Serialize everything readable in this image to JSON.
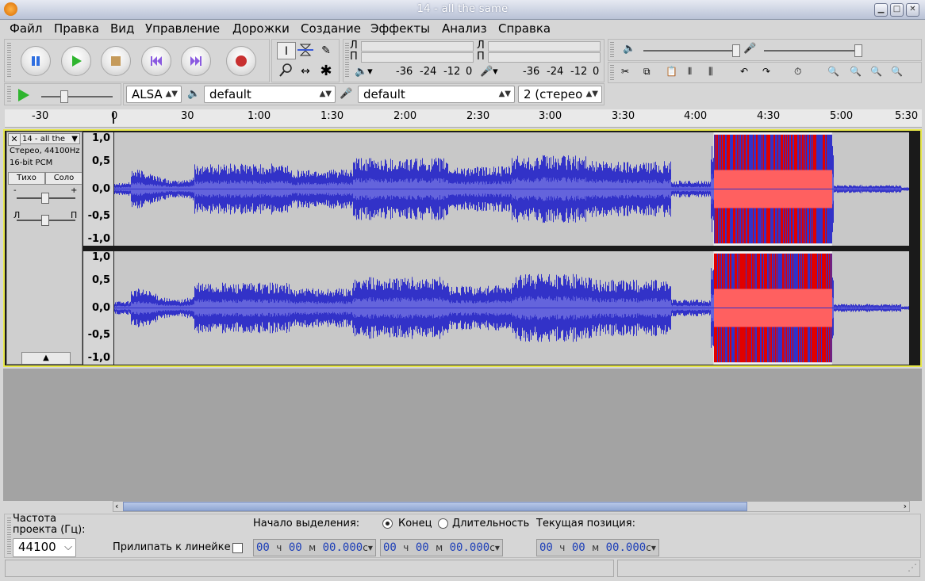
{
  "window": {
    "title": "14 - all the same"
  },
  "menu": [
    {
      "label": "Файл"
    },
    {
      "label": "Правка"
    },
    {
      "label": "Вид"
    },
    {
      "label": "Управление"
    },
    {
      "label": "Дорожки"
    },
    {
      "label": "Создание"
    },
    {
      "label": "Эффекты"
    },
    {
      "label": "Анализ"
    },
    {
      "label": "Справка"
    }
  ],
  "meters": {
    "play_channels": [
      "Л",
      "П"
    ],
    "rec_channels": [
      "Л",
      "П"
    ],
    "scale": [
      "-36",
      "-24",
      "-12",
      "0"
    ]
  },
  "device": {
    "host": "ALSA",
    "playback": "default",
    "recording": "default",
    "channels": "2 (стерео"
  },
  "ruler": {
    "ticks": [
      "-30",
      "0",
      "30",
      "1:00",
      "1:30",
      "2:00",
      "2:30",
      "3:00",
      "3:30",
      "4:00",
      "4:30",
      "5:00",
      "5:30"
    ]
  },
  "track": {
    "name": "14 - all the",
    "info1": "Стерео, 44100Hz",
    "info2": "16-bit PCM",
    "mute": "Тихо",
    "solo": "Соло",
    "pan_left": "Л",
    "pan_right": "П",
    "scale": [
      "1,0",
      "0,5",
      "0,0",
      "-0,5",
      "-1,0"
    ],
    "selection_fraction": [
      0.754,
      0.903
    ]
  },
  "colors": {
    "wave": "#3232c8",
    "wave_rms": "#6464dc",
    "selection": "#e00000",
    "track_border": "#e8e84a"
  },
  "bottom": {
    "rate_label_1": "Частота",
    "rate_label_2": "проекта (Гц):",
    "rate_value": "44100",
    "snap_label": "Прилипать к линейке",
    "sel_start_label": "Начало выделения:",
    "end_label": "Конец",
    "length_label": "Длительность",
    "pos_label": "Текущая позиция:",
    "time1": {
      "h": "00",
      "m": "00",
      "s": "00.000"
    },
    "time2": {
      "h": "00",
      "m": "00",
      "s": "00.000"
    },
    "time3": {
      "h": "00",
      "m": "00",
      "s": "00.000"
    },
    "unit_h": "ч",
    "unit_m": "м",
    "unit_s": "с"
  }
}
